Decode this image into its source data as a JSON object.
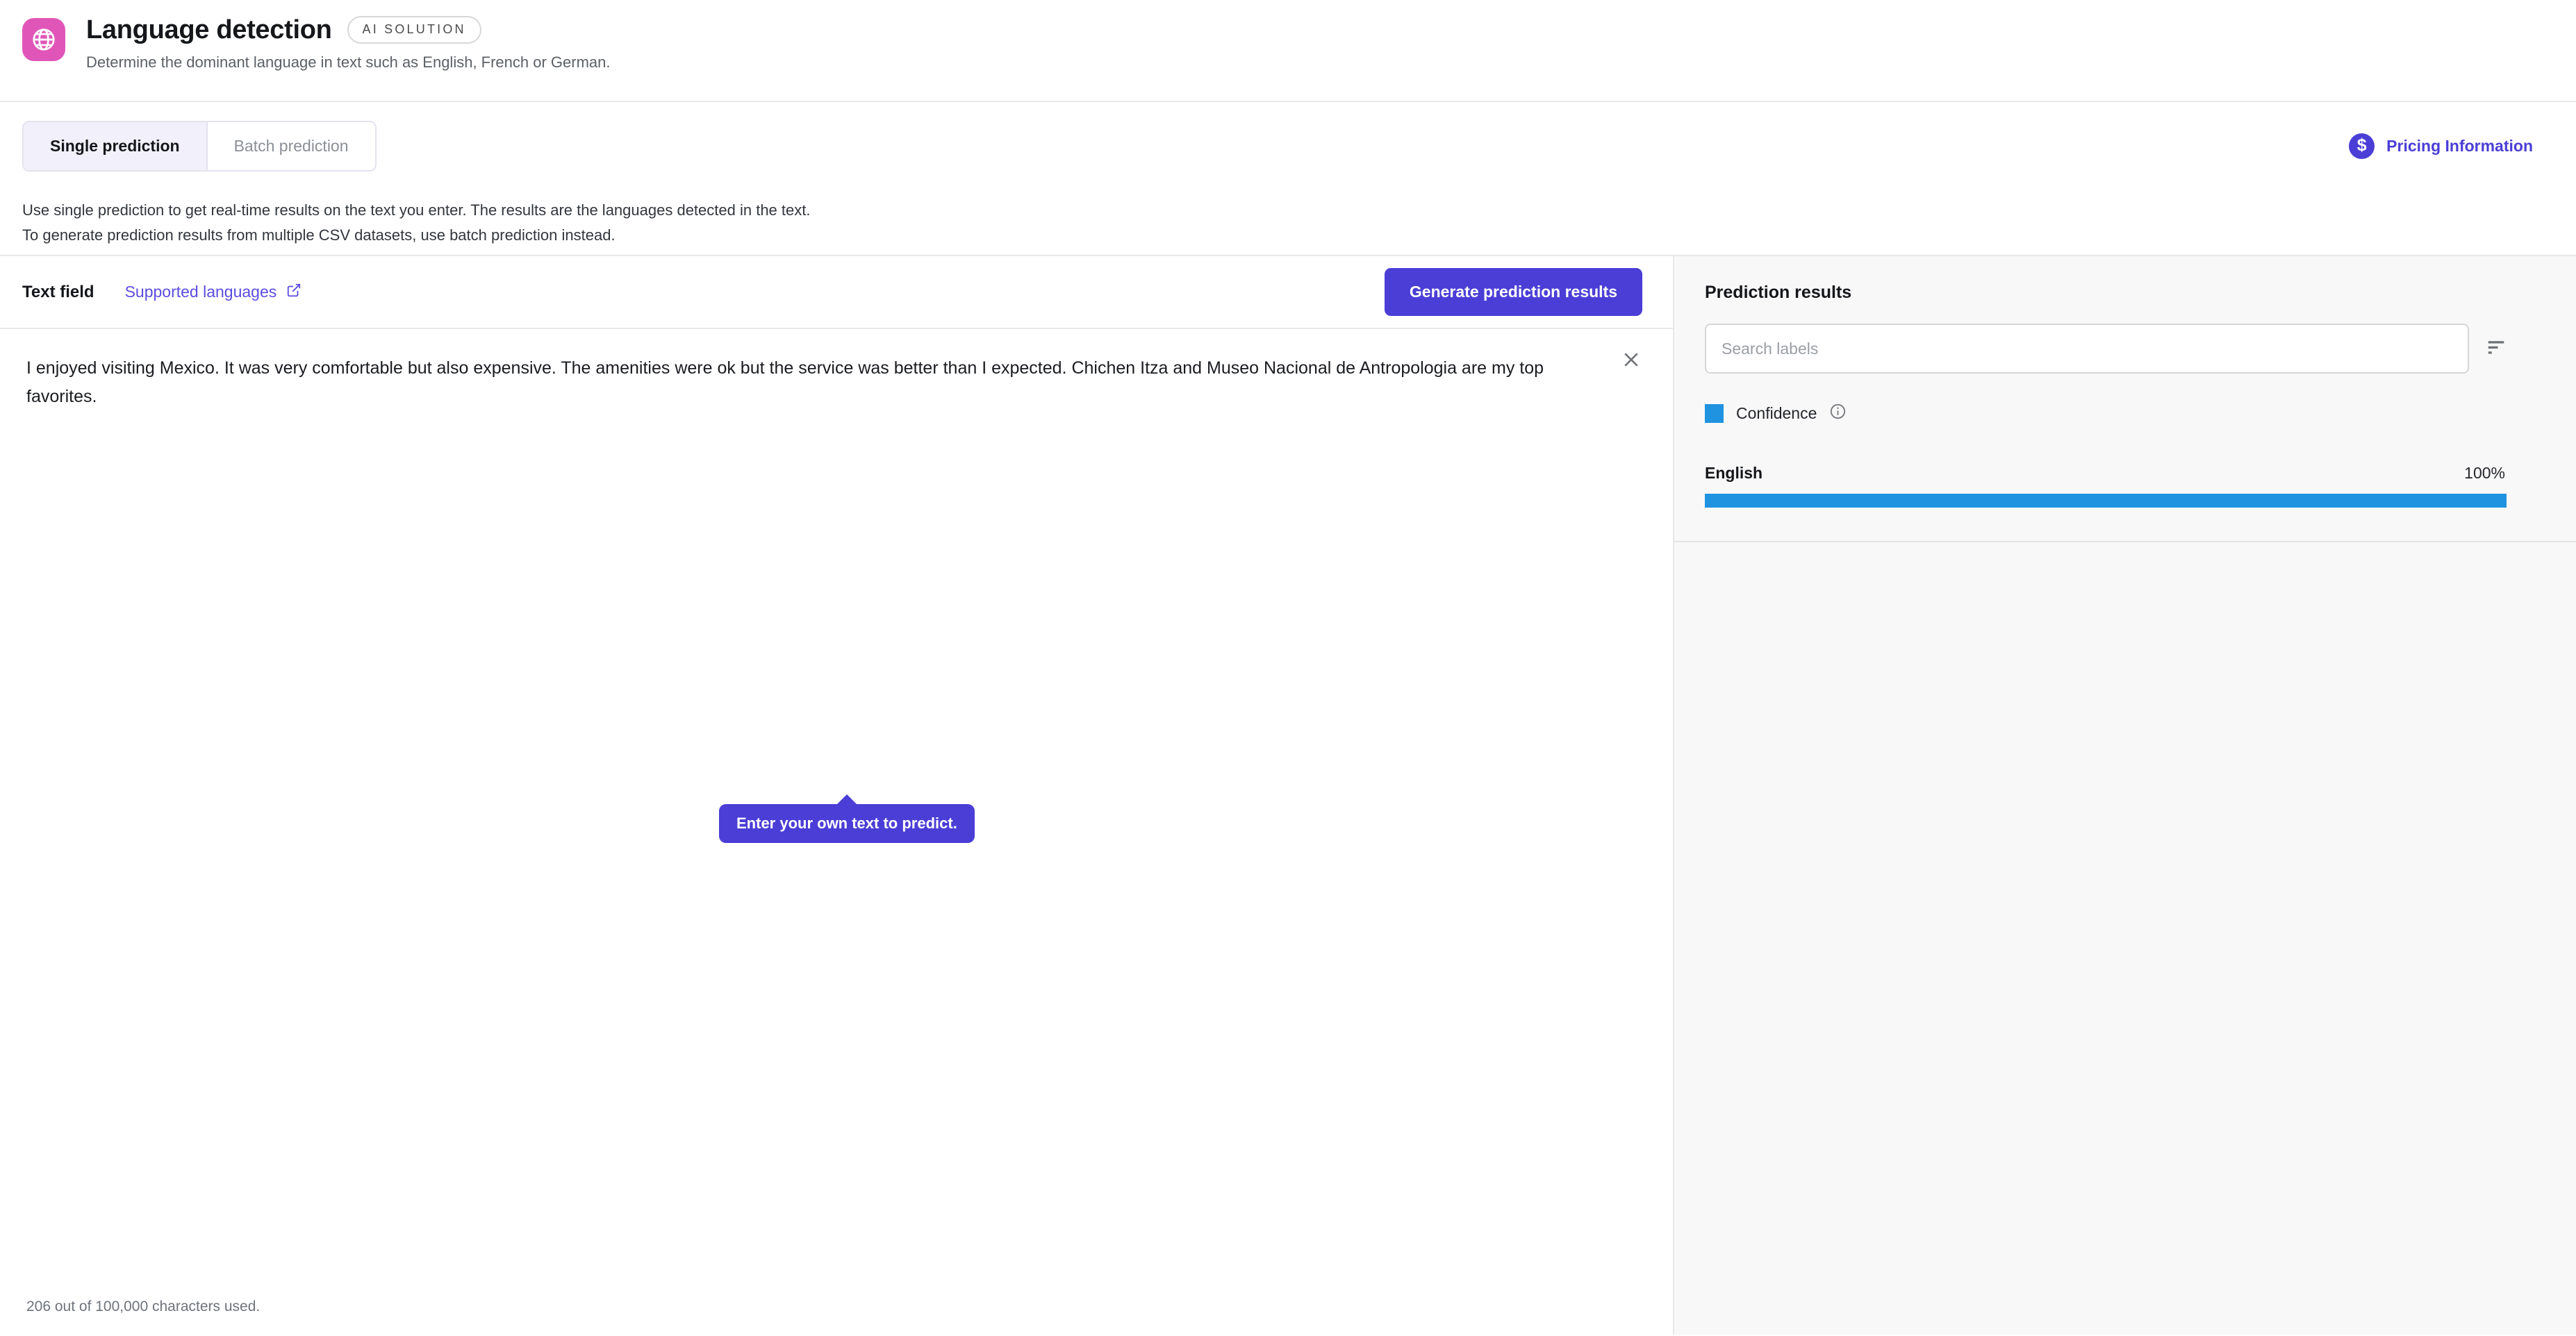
{
  "header": {
    "icon": "globe-icon",
    "icon_bg": "#e056b8",
    "title": "Language detection",
    "badge": "AI SOLUTION",
    "subtitle": "Determine the dominant language in text such as English, French or German."
  },
  "tabs": {
    "items": [
      {
        "label": "Single prediction",
        "active": true
      },
      {
        "label": "Batch prediction",
        "active": false
      }
    ],
    "pricing": {
      "icon": "dollar-circle-icon",
      "label": "Pricing Information",
      "color": "#4a3ed6"
    },
    "description_line1": "Use single prediction to get real-time results on the text you enter. The results are the languages detected in the text.",
    "description_line2": "To generate prediction results from multiple CSV datasets, use batch prediction instead."
  },
  "editor": {
    "field_label": "Text field",
    "supported_languages_link": "Supported languages",
    "external_icon": "external-link-icon",
    "generate_button": "Generate prediction results",
    "close_icon": "close-icon",
    "text_value": "I enjoyed visiting Mexico. It was very comfortable but also expensive. The amenities were ok but the service was better than I expected. Chichen Itza and Museo Nacional de Antropologia are my top favorites.",
    "tooltip": "Enter your own text to predict.",
    "char_counter": "206 out of 100,000 characters used."
  },
  "results": {
    "title": "Prediction results",
    "search_placeholder": "Search labels",
    "search_value": "",
    "sort_icon": "sort-descending-icon",
    "legend": {
      "label": "Confidence",
      "color": "#1f92e0",
      "info_icon": "info-icon"
    },
    "items": [
      {
        "label": "English",
        "value": "100%",
        "percent": 100
      }
    ]
  }
}
